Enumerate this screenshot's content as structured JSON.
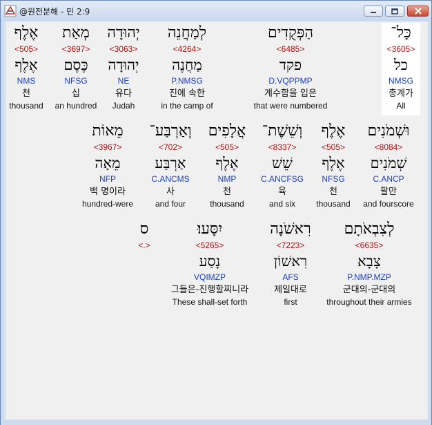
{
  "window": {
    "title": "@원전분해 - 민 2:9"
  },
  "rows": [
    [
      {
        "heb": "כָּל־",
        "num": "<3605>",
        "lemma": "כל",
        "parse": "NMSG",
        "kor": "총계가",
        "eng": "All",
        "selected": true
      },
      {
        "heb": "הַפְּקֻדִים",
        "num": "<6485>",
        "lemma": "פקד",
        "parse": "D.VQPPMP",
        "kor": "계수함을 입은",
        "eng": "that were numbered"
      },
      {
        "heb": "לְמַחֲנֵה",
        "num": "<4264>",
        "lemma": "מַחֲנֶה",
        "parse": "P.NMSG",
        "kor": "진에 속한",
        "eng": "in the camp of"
      },
      {
        "heb": "יְהוּדָה",
        "num": "<3063>",
        "lemma": "יְהוּדָה",
        "parse": "NE",
        "kor": "유다",
        "eng": "Judah"
      },
      {
        "heb": "מְאַת",
        "num": "<3697>",
        "lemma": "כֶּסֶם",
        "parse": "NFSG",
        "kor": "십",
        "eng": "an hundred"
      },
      {
        "heb": "אֶלֶף",
        "num": "<505>",
        "lemma": "אֶלֶף",
        "parse": "NMS",
        "kor": "천",
        "eng": "thousand"
      }
    ],
    [
      {
        "heb": "וּשְׁמֹנִים",
        "num": "<8084>",
        "lemma": "שְׁמֹנִים",
        "parse": "C.ANCP",
        "kor": "팔만",
        "eng": "and fourscore"
      },
      {
        "heb": "אֶלֶף",
        "num": "<505>",
        "lemma": "אֶלֶף",
        "parse": "NFSG",
        "kor": "천",
        "eng": "thousand"
      },
      {
        "heb": "וְשֵׁשֶׁת־",
        "num": "<8337>",
        "lemma": "שֵׁשׁ",
        "parse": "C.ANCFSG",
        "kor": "육",
        "eng": "and six"
      },
      {
        "heb": "אֲלָפִים",
        "num": "<505>",
        "lemma": "אֶלֶף",
        "parse": "NMP",
        "kor": "천",
        "eng": "thousand"
      },
      {
        "heb": "וְאַרְבַּע־",
        "num": "<702>",
        "lemma": "אַרְבַּע",
        "parse": "C.ANCMS",
        "kor": "사",
        "eng": "and four"
      },
      {
        "heb": "מֵאוֹת",
        "num": "<3967>",
        "lemma": "מֵאָה",
        "parse": "NFP",
        "kor": "백 명이라",
        "eng": "hundred-were"
      }
    ],
    [
      {
        "heb": "לְצִבְאֹתָם",
        "num": "<6635>",
        "lemma": "צָבָא",
        "parse": "P.NMP.MZP",
        "kor": "군대의-군대의",
        "eng": "throughout their armies"
      },
      {
        "heb": "רִאשֹׁנָה",
        "num": "<7223>",
        "lemma": "רִאשׁוֹן",
        "parse": "AFS",
        "kor": "제일대로",
        "eng": "first"
      },
      {
        "heb": "יִסָּעוּ׃",
        "num": "<5265>",
        "lemma": "נָסַע",
        "parse": "VQIMZP",
        "kor": "그들은-진행할찌니라",
        "eng": "These shall-set forth"
      },
      {
        "heb": "ס",
        "num": "<.>",
        "lemma": "",
        "parse": "",
        "kor": "",
        "eng": ""
      }
    ]
  ]
}
